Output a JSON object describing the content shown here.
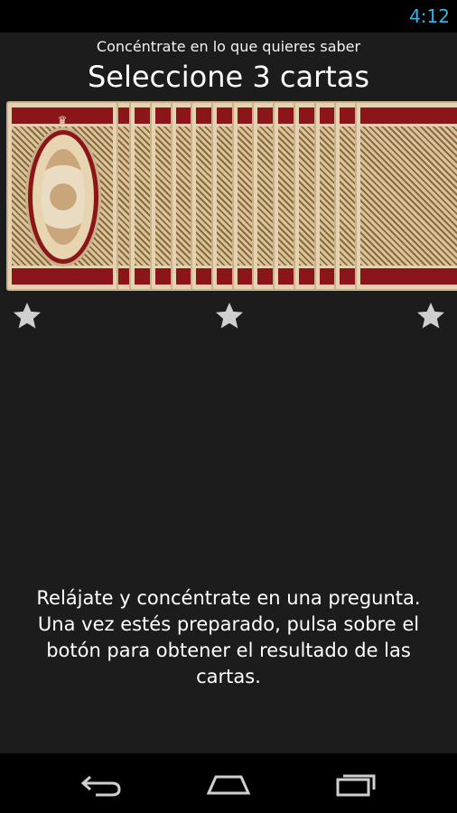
{
  "status_bar": {
    "time": "4:12"
  },
  "header": {
    "subtitle": "Concéntrate en lo que quieres saber",
    "title": "Seleccione 3 cartas"
  },
  "deck": {
    "card_count": 18
  },
  "stars": {
    "count": 3,
    "color": "#cfcfcf"
  },
  "instructions": "Relájate y concéntrate en una pregunta. Una vez estés preparado, pulsa sobre el botón para obtener el resultado de las cartas.",
  "nav": {
    "back_icon": "back-icon",
    "home_icon": "home-icon",
    "recents_icon": "recent-apps-icon"
  },
  "colors": {
    "accent": "#33b5e5",
    "card_red": "#8c1519",
    "card_cream": "#e4d2b2"
  }
}
